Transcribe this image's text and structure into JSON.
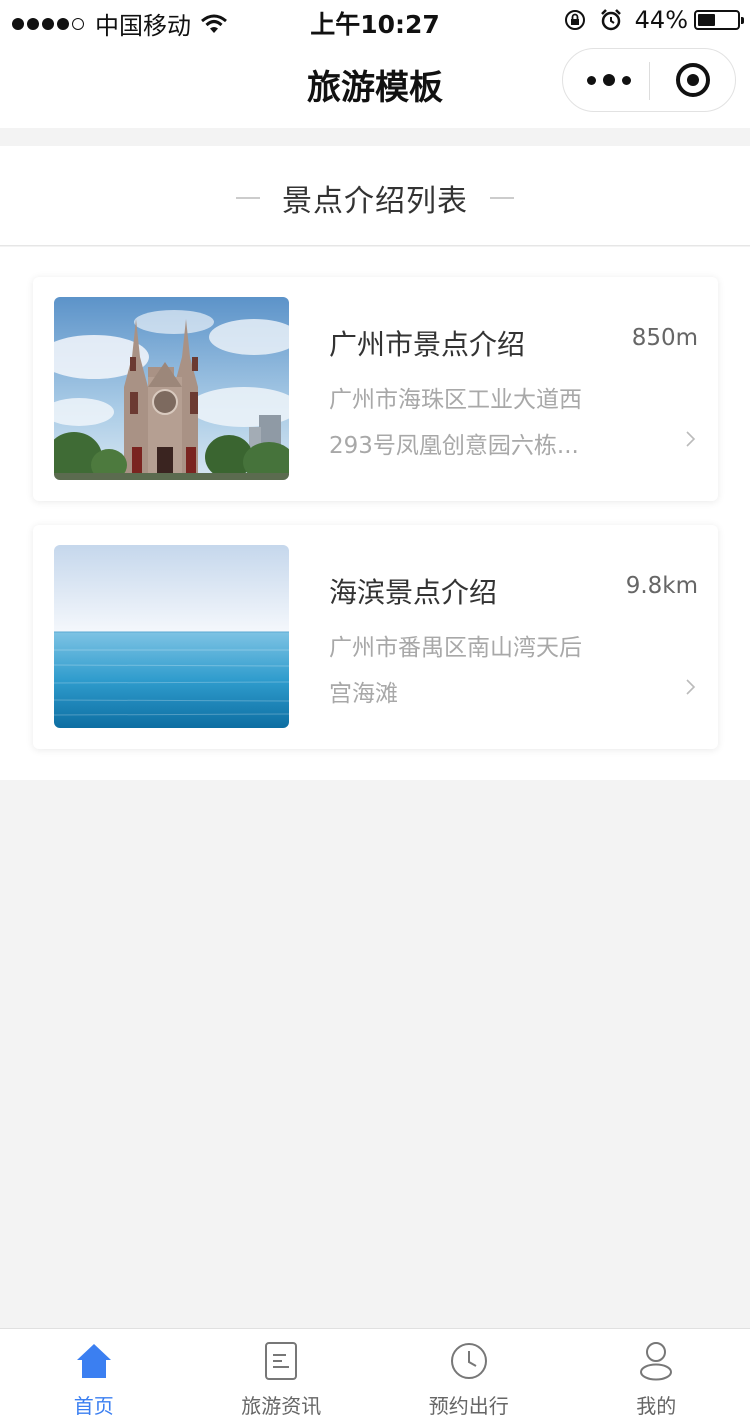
{
  "status_bar": {
    "carrier": "中国移动",
    "time": "上午10:27",
    "battery_percent": "44%",
    "battery_level": 0.44
  },
  "nav": {
    "title": "旅游模板"
  },
  "section": {
    "title": "景点介绍列表"
  },
  "spots": [
    {
      "title": "广州市景点介绍",
      "distance": "850m",
      "address_line1": "广州市海珠区工业大道西",
      "address_line2": "293号凤凰创意园六栋...",
      "image": "church-photo"
    },
    {
      "title": "海滨景点介绍",
      "distance": "9.8km",
      "address_line1": "广州市番禺区南山湾天后",
      "address_line2": "宫海滩",
      "image": "sea-photo"
    }
  ],
  "tabs": [
    {
      "label": "首页",
      "icon": "home-icon",
      "active": true
    },
    {
      "label": "旅游资讯",
      "icon": "document-icon",
      "active": false
    },
    {
      "label": "预约出行",
      "icon": "clock-icon",
      "active": false
    },
    {
      "label": "我的",
      "icon": "user-icon",
      "active": false
    }
  ],
  "colors": {
    "accent": "#3b7ff1",
    "background": "#f3f3f3",
    "inactive_tab": "#666666"
  }
}
